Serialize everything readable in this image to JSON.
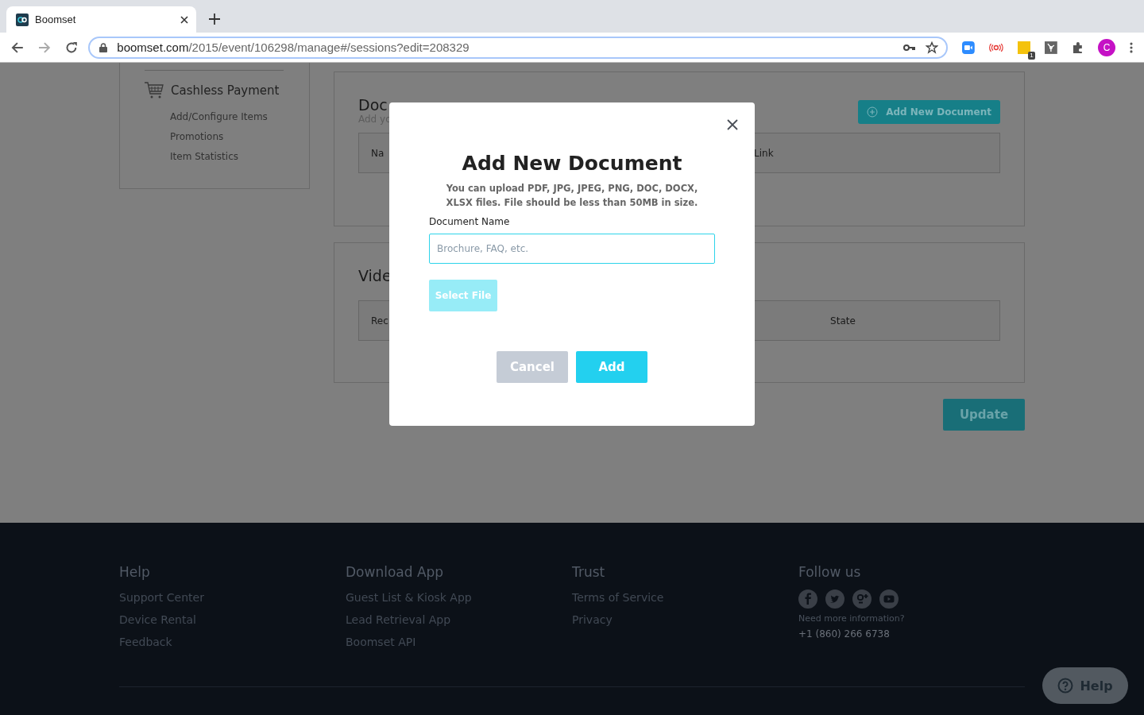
{
  "browser": {
    "tab_title": "Boomset",
    "url_host": "boomset.com",
    "url_path": "/2015/event/106298/manage#/sessions?edit=208329",
    "extension_badge": "1",
    "profile_initial": "C"
  },
  "sidebar": {
    "section": "Cashless Payment",
    "items": [
      "Add/Configure Items",
      "Promotions",
      "Item Statistics"
    ]
  },
  "documents": {
    "title": "Doc",
    "subtitle": "Add yo",
    "add_button": "Add New Document",
    "columns": [
      "Na",
      "Link"
    ]
  },
  "videos": {
    "title": "Vide",
    "columns": [
      "Rec",
      "State"
    ]
  },
  "update_button": "Update",
  "modal": {
    "title": "Add New Document",
    "description": "You can upload PDF, JPG, JPEG, PNG, DOC, DOCX, XLSX files. File should be less than 50MB in size.",
    "field_label": "Document Name",
    "placeholder": "Brochure, FAQ, etc.",
    "select_button": "Select File",
    "cancel_button": "Cancel",
    "add_button": "Add"
  },
  "footer": {
    "columns": [
      {
        "heading": "Help",
        "links": [
          "Support Center",
          "Device Rental",
          "Feedback"
        ]
      },
      {
        "heading": "Download App",
        "links": [
          "Guest List & Kiosk App",
          "Lead Retrieval App",
          "Boomset API"
        ]
      },
      {
        "heading": "Trust",
        "links": [
          "Terms of Service",
          "Privacy"
        ]
      }
    ],
    "follow": {
      "heading": "Follow us",
      "note": "Need more information?",
      "phone": "+1 (860) 266 6738"
    }
  },
  "help_button": "Help"
}
